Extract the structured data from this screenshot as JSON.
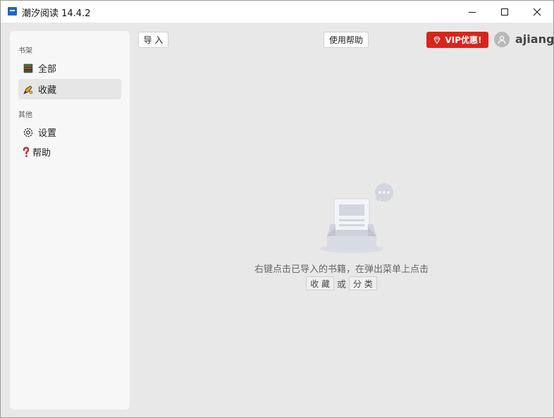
{
  "window": {
    "title": "潮汐阅读 14.4.2"
  },
  "sidebar": {
    "section_bookshelf": "书架",
    "section_other": "其他",
    "items": [
      {
        "label": "全部",
        "icon": "books-icon"
      },
      {
        "label": "收藏",
        "icon": "pen-star-icon",
        "active": true
      },
      {
        "label": "设置",
        "icon": "gear-icon"
      },
      {
        "label": "帮助",
        "icon": "question-icon"
      }
    ]
  },
  "toolbar": {
    "import_label": "导 入",
    "help_label": "使用帮助",
    "vip_label": "VIP优惠!",
    "username": "ajiang"
  },
  "empty_state": {
    "message": "右键点击已导入的书籍，在弹出菜单上点击",
    "favorite_label": "收 藏",
    "or_label": "或",
    "category_label": "分 类"
  },
  "colors": {
    "vip_red": "#d9241c",
    "app_icon_blue": "#1e64c8",
    "background": "#e8e8e8",
    "sidebar_bg": "#f7f7f7"
  }
}
